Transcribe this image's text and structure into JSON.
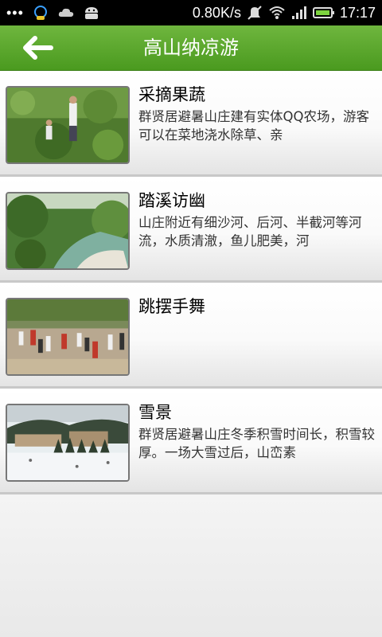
{
  "status_bar": {
    "left_dots": "•••",
    "speed": "0.80K/s",
    "time": "17:17",
    "icons": [
      "chat-bubble-icon",
      "cloud-icon",
      "android-icon",
      "mute-icon",
      "wifi-icon",
      "signal-icon",
      "battery-icon"
    ]
  },
  "header": {
    "title": "高山纳凉游",
    "back_icon": "arrow-left-icon"
  },
  "items": [
    {
      "title": "采摘果蔬",
      "desc": "群贤居避暑山庄建有实体QQ农场，游客可以在菜地浇水除草、亲"
    },
    {
      "title": "踏溪访幽",
      "desc": "山庄附近有细沙河、后河、半截河等河流，水质清澈，鱼儿肥美，河"
    },
    {
      "title": "跳摆手舞",
      "desc": ""
    },
    {
      "title": "雪景",
      "desc": "群贤居避暑山庄冬季积雪时间长，积雪较厚。一场大雪过后，山峦素"
    }
  ],
  "colors": {
    "header_green": "#5aa82b",
    "status_bg": "#000000"
  }
}
